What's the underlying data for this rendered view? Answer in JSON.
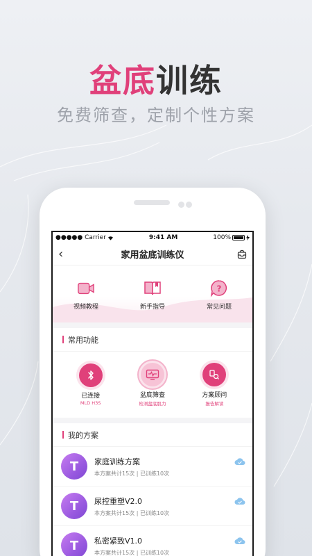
{
  "promo": {
    "title_highlight": "盆底",
    "title_rest": "训练",
    "subtitle": "免费筛查，定制个性方案"
  },
  "status_bar": {
    "carrier": "●●●●● Carrier",
    "time": "9:41 AM",
    "battery": "100%"
  },
  "nav": {
    "back_icon": "‹",
    "title": "家用盆底训练仪"
  },
  "quick_links": [
    {
      "label": "视频教程",
      "icon": "video-icon"
    },
    {
      "label": "新手指导",
      "icon": "book-icon"
    },
    {
      "label": "常见问题",
      "icon": "question-icon"
    }
  ],
  "common_functions": {
    "title": "常用功能",
    "items": [
      {
        "label": "已连接",
        "sub": "MLD H3S",
        "icon": "bluetooth-icon"
      },
      {
        "label": "盆底筛查",
        "sub": "检测盆底肌力",
        "icon": "monitor-icon"
      },
      {
        "label": "方案顾问",
        "sub": "报告解读",
        "icon": "advisor-icon"
      }
    ]
  },
  "my_plans": {
    "title": "我的方案",
    "items": [
      {
        "avatar": "T",
        "name": "家庭训练方案",
        "meta": "本方案共计15次 | 已训练10次"
      },
      {
        "avatar": "T",
        "name": "尿控重塑V2.0",
        "meta": "本方案共计15次 | 已训练10次"
      },
      {
        "avatar": "T",
        "name": "私密紧致V1.0",
        "meta": "本方案共计15次 | 已训练10次"
      }
    ]
  },
  "colors": {
    "accent": "#e0407a",
    "accent_light": "#f3b3cb",
    "avatar_purple": "#9a5ae0",
    "cloud_blue": "#8cc4ee"
  }
}
